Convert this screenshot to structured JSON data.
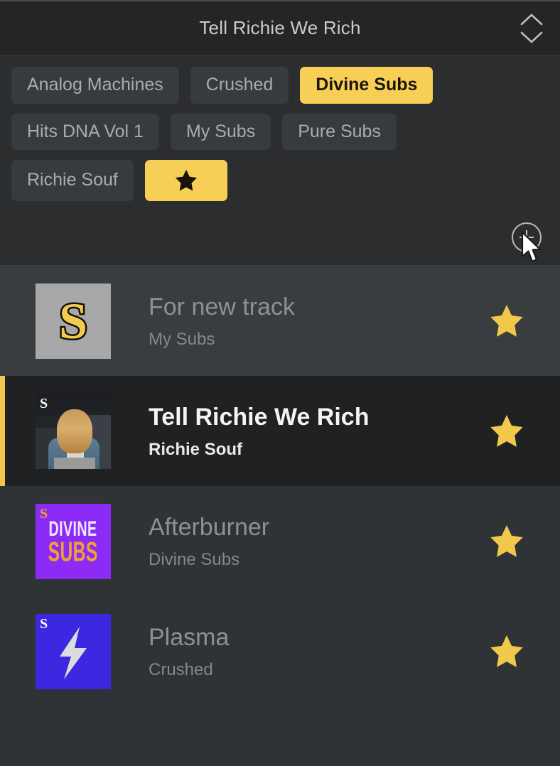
{
  "header": {
    "title": "Tell Richie We Rich",
    "stepper_up_icon": "chevron-up-icon",
    "stepper_down_icon": "chevron-down-icon"
  },
  "tagbar": {
    "add_tag_icon": "plus-circle-icon",
    "cursor_icon": "mouse-pointer-icon",
    "rows": [
      [
        {
          "label": "Analog Machines",
          "active": false
        },
        {
          "label": "Crushed",
          "active": false
        },
        {
          "label": "Divine Subs",
          "active": true
        }
      ],
      [
        {
          "label": "Hits DNA Vol 1",
          "active": false
        },
        {
          "label": "My Subs",
          "active": false
        },
        {
          "label": "Pure Subs",
          "active": false
        }
      ],
      [
        {
          "label": "Richie Souf",
          "active": false
        },
        {
          "label": "",
          "active": true,
          "icon": "star-icon"
        }
      ]
    ]
  },
  "list": {
    "star_icon": "star-icon",
    "tracks": [
      {
        "title": "For new track",
        "subtitle": "My Subs",
        "starred": true,
        "selected": false,
        "thumb": {
          "kind": "gray-s-logo",
          "badge": "S",
          "badge_color": "#f3cb4e"
        }
      },
      {
        "title": "Tell Richie We Rich",
        "subtitle": "Richie Souf",
        "starred": true,
        "selected": true,
        "thumb": {
          "kind": "photo",
          "badge": "S",
          "badge_color": "#ffffff"
        }
      },
      {
        "title": "Afterburner",
        "subtitle": "Divine Subs",
        "starred": true,
        "selected": false,
        "thumb": {
          "kind": "divine-subs-art",
          "badge": "S",
          "badge_color": "#f0a132",
          "art_line1": "DIVINE",
          "art_line2": "SUBS",
          "bg": "#8c2bf5"
        }
      },
      {
        "title": "Plasma",
        "subtitle": "Crushed",
        "starred": true,
        "selected": false,
        "thumb": {
          "kind": "lightning-bolt-art",
          "badge": "S",
          "badge_color": "#ffffff",
          "bg": "#3b28e0"
        }
      }
    ]
  },
  "colors": {
    "accent_yellow": "#f7cf57",
    "star_gold": "#f2c84b",
    "panel_bg": "#2b2d2f",
    "list_bg": "#303335",
    "row_alt_bg": "#3a3d3f",
    "selected_row_bg": "#1f2123",
    "header_bg": "#232527"
  }
}
